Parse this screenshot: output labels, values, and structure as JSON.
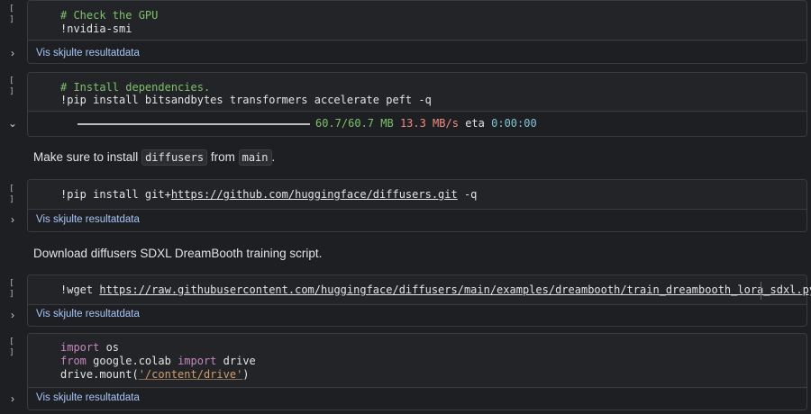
{
  "cells": [
    {
      "run": "[ ]",
      "lines": [
        [
          {
            "t": "comment",
            "v": "# Check the GPU"
          }
        ],
        [
          {
            "t": "code",
            "v": "!nvidia-smi"
          }
        ]
      ],
      "output_toggle": "›",
      "output_link": "Vis skjulte resultatdata"
    },
    {
      "run": "[ ]",
      "lines": [
        [
          {
            "t": "comment",
            "v": "# Install dependencies."
          }
        ],
        [
          {
            "t": "code",
            "v": "!pip install bitsandbytes transformers accelerate peft -q"
          }
        ]
      ],
      "output_toggle": "⌄",
      "progress": {
        "fraction": 1.0,
        "size": "60.7/60.7 MB",
        "speed": "13.3 MB/s",
        "eta_label": "eta",
        "eta": "0:00:00"
      }
    },
    {
      "run": "[ ]",
      "lines": [
        [
          {
            "t": "code",
            "v": "!pip install git+"
          },
          {
            "t": "url",
            "v": "https://github.com/huggingface/diffusers.git"
          },
          {
            "t": "code",
            "v": " -q"
          }
        ]
      ],
      "output_toggle": "›",
      "output_link": "Vis skjulte resultatdata"
    },
    {
      "run": "[ ]",
      "lines": [
        [
          {
            "t": "code",
            "v": "!wget "
          },
          {
            "t": "url",
            "v": "https://raw.githubusercontent.com/huggingface/diffusers/main/examples/dreambooth/train_dreambooth_lora_sdxl.py"
          }
        ]
      ],
      "output_toggle": "›",
      "output_link": "Vis skjulte resultatdata"
    },
    {
      "run": "[ ]",
      "lines": [
        [
          {
            "t": "kw",
            "v": "import"
          },
          {
            "t": "code",
            "v": " os"
          }
        ],
        [
          {
            "t": "kw",
            "v": "from"
          },
          {
            "t": "code",
            "v": " google.colab "
          },
          {
            "t": "kw",
            "v": "import"
          },
          {
            "t": "code",
            "v": " drive"
          }
        ],
        [
          {
            "t": "code",
            "v": "drive.mount("
          },
          {
            "t": "str",
            "v": "'/content/drive'"
          },
          {
            "t": "code",
            "v": ")"
          }
        ]
      ],
      "output_toggle": "›",
      "output_link": "Vis skjulte resultatdata"
    }
  ],
  "markdown": [
    {
      "parts": [
        {
          "t": "text",
          "v": "Make sure to install "
        },
        {
          "t": "code",
          "v": "diffusers"
        },
        {
          "t": "text",
          "v": " from "
        },
        {
          "t": "code",
          "v": "main"
        },
        {
          "t": "text",
          "v": "."
        }
      ]
    },
    {
      "parts": [
        {
          "t": "text",
          "v": "Download diffusers SDXL DreamBooth training script."
        }
      ]
    }
  ]
}
